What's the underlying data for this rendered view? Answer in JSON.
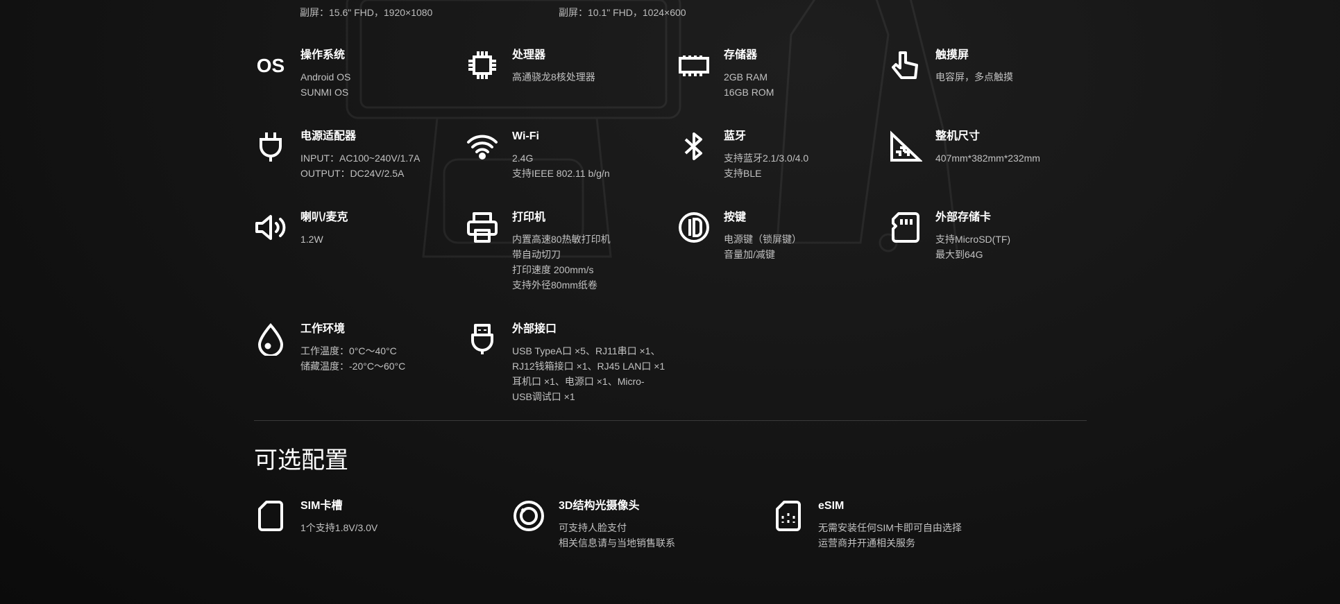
{
  "top_partial": [
    {
      "text": "副屏：15.6\" FHD，1920×1080"
    },
    {
      "text": "副屏：10.1\" FHD，1024×600"
    }
  ],
  "specs": [
    {
      "icon": "os-icon",
      "title": "操作系统",
      "lines": [
        "Android OS",
        "SUNMI OS"
      ]
    },
    {
      "icon": "cpu-icon",
      "title": "处理器",
      "lines": [
        "高通骁龙8核处理器"
      ]
    },
    {
      "icon": "memory-icon",
      "title": "存储器",
      "lines": [
        "2GB RAM",
        "16GB ROM"
      ]
    },
    {
      "icon": "touch-hand-icon",
      "title": "触摸屏",
      "lines": [
        "电容屏，多点触摸"
      ]
    },
    {
      "icon": "power-plug-icon",
      "title": "电源适配器",
      "lines": [
        "INPUT：AC100~240V/1.7A",
        "OUTPUT：DC24V/2.5A"
      ]
    },
    {
      "icon": "wifi-icon",
      "title": "Wi-Fi",
      "lines": [
        "2.4G",
        "支持IEEE 802.11 b/g/n"
      ]
    },
    {
      "icon": "bluetooth-icon",
      "title": "蓝牙",
      "lines": [
        "支持蓝牙2.1/3.0/4.0",
        "支持BLE"
      ]
    },
    {
      "icon": "dimensions-icon",
      "title": "整机尺寸",
      "lines": [
        "407mm*382mm*232mm"
      ]
    },
    {
      "icon": "speaker-icon",
      "title": "喇叭/麦克",
      "lines": [
        "1.2W"
      ]
    },
    {
      "icon": "printer-icon",
      "title": "打印机",
      "lines": [
        "内置高速80热敏打印机",
        "带自动切刀",
        "打印速度 200mm/s",
        "支持外径80mm纸卷"
      ]
    },
    {
      "icon": "power-button-icon",
      "title": "按键",
      "lines": [
        "电源键（锁屏键）",
        "音量加/减键"
      ]
    },
    {
      "icon": "sd-card-icon",
      "title": "外部存储卡",
      "lines": [
        "支持MicroSD(TF)",
        "最大到64G"
      ]
    },
    {
      "icon": "water-drop-icon",
      "title": "工作环境",
      "lines": [
        "工作温度：0°C～40°C",
        "储藏温度：-20°C～60°C"
      ]
    },
    {
      "icon": "usb-plug-icon",
      "title": "外部接口",
      "lines": [
        "USB TypeA口 ×5、RJ11串口 ×1、",
        "RJ12钱箱接口 ×1、RJ45 LAN口 ×1",
        "耳机口 ×1、电源口 ×1、Micro-",
        "USB调试口 ×1"
      ]
    }
  ],
  "optional_section": {
    "title": "可选配置",
    "items": [
      {
        "icon": "sim-slot-icon",
        "title": "SIM卡槽",
        "lines": [
          "1个支持1.8V/3.0V"
        ]
      },
      {
        "icon": "camera-3d-icon",
        "title": "3D结构光摄像头",
        "lines": [
          "可支持人脸支付",
          "相关信息请与当地销售联系"
        ]
      },
      {
        "icon": "esim-icon",
        "title": "eSIM",
        "lines": [
          "无需安装任何SIM卡即可自由选择",
          "运营商并开通相关服务"
        ]
      }
    ]
  }
}
